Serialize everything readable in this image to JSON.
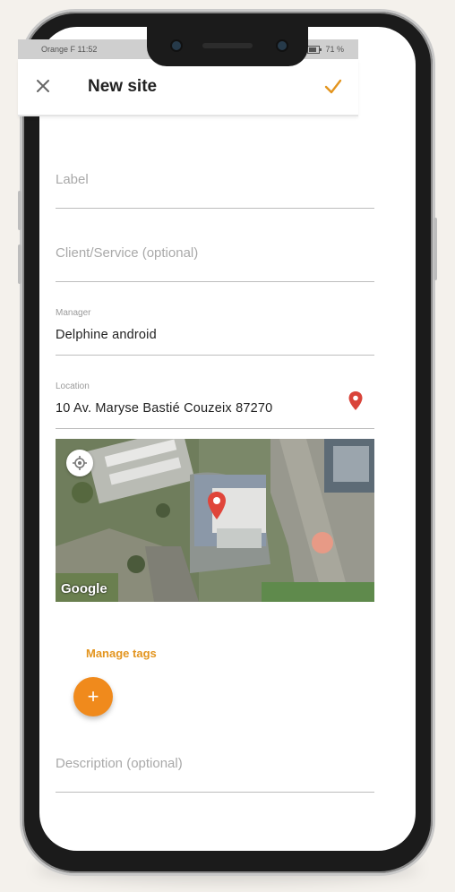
{
  "status_bar": {
    "carrier_time": "Orange F 11:52",
    "battery": "71 %"
  },
  "app_bar": {
    "title": "New site",
    "close_icon": "close-icon",
    "confirm_icon": "check-icon",
    "accent_color": "#e3951f"
  },
  "form": {
    "label_placeholder": "Label",
    "client_placeholder": "Client/Service (optional)",
    "manager": {
      "label": "Manager",
      "value": "Delphine android"
    },
    "location": {
      "label": "Location",
      "value": "10 Av. Maryse Bastié Couzeix 87270",
      "pin_icon": "map-pin-icon",
      "pin_color": "#d9443a"
    },
    "map": {
      "attribution": "Google",
      "locate_icon": "my-location-icon"
    },
    "tags_label": "Manage tags",
    "add_tag_icon": "+",
    "description_placeholder": "Description (optional)"
  }
}
